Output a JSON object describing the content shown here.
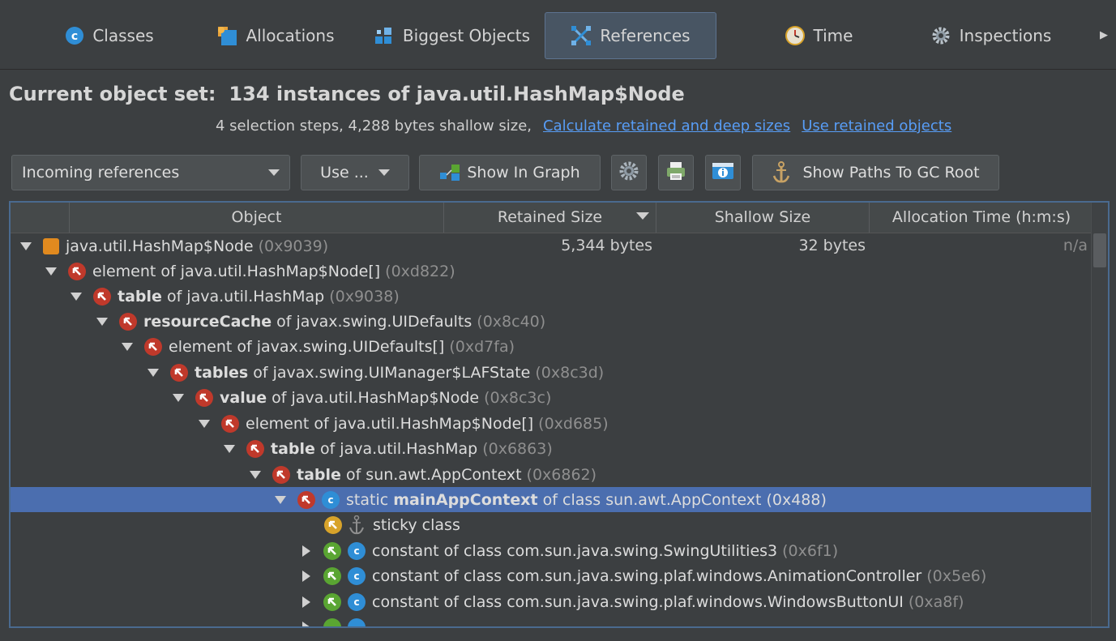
{
  "tabs": [
    {
      "label": "Classes",
      "icon": "classes-icon"
    },
    {
      "label": "Allocations",
      "icon": "allocations-icon"
    },
    {
      "label": "Biggest Objects",
      "icon": "biggest-objects-icon"
    },
    {
      "label": "References",
      "icon": "references-icon"
    },
    {
      "label": "Time",
      "icon": "time-icon"
    },
    {
      "label": "Inspections",
      "icon": "inspections-icon"
    }
  ],
  "header": {
    "title_label": "Current object set:",
    "title_value": "134 instances of java.util.HashMap$Node",
    "subtitle": "4 selection steps, 4,288 bytes shallow size,",
    "link_calc": "Calculate retained and deep sizes",
    "link_use": "Use retained objects"
  },
  "toolbar": {
    "combo_value": "Incoming references",
    "use_label": "Use ...",
    "graph_label": "Show In Graph",
    "gc_label": "Show Paths To GC Root"
  },
  "table": {
    "columns": [
      "Object",
      "Retained Size",
      "Shallow Size",
      "Allocation Time (h:m:s)"
    ],
    "root_retained": "5,344 bytes",
    "root_shallow": "32 bytes",
    "root_alloc": "n/a",
    "rows": [
      {
        "prefix": "",
        "bold": "",
        "text": "java.util.HashMap$Node",
        "addr": "(0x9039)"
      },
      {
        "prefix": "",
        "bold": "",
        "text": "element of java.util.HashMap$Node[]",
        "addr": "(0xd822)"
      },
      {
        "prefix": "",
        "bold": "table",
        "text": " of java.util.HashMap",
        "addr": "(0x9038)"
      },
      {
        "prefix": "",
        "bold": "resourceCache",
        "text": " of javax.swing.UIDefaults",
        "addr": "(0x8c40)"
      },
      {
        "prefix": "",
        "bold": "",
        "text": "element of javax.swing.UIDefaults[]",
        "addr": "(0xd7fa)"
      },
      {
        "prefix": "",
        "bold": "tables",
        "text": " of javax.swing.UIManager$LAFState",
        "addr": "(0x8c3d)"
      },
      {
        "prefix": "",
        "bold": "value",
        "text": " of java.util.HashMap$Node",
        "addr": "(0x8c3c)"
      },
      {
        "prefix": "",
        "bold": "",
        "text": "element of java.util.HashMap$Node[]",
        "addr": "(0xd685)"
      },
      {
        "prefix": "",
        "bold": "table",
        "text": " of java.util.HashMap",
        "addr": "(0x6863)"
      },
      {
        "prefix": "",
        "bold": "table",
        "text": " of sun.awt.AppContext",
        "addr": "(0x6862)"
      },
      {
        "prefix": "static ",
        "bold": "mainAppContext",
        "text": " of class sun.awt.AppContext",
        "addr": "(0x488)"
      },
      {
        "prefix": "",
        "bold": "",
        "text": "sticky class",
        "addr": ""
      },
      {
        "prefix": "",
        "bold": "",
        "text": "constant of class com.sun.java.swing.SwingUtilities3",
        "addr": "(0x6f1)"
      },
      {
        "prefix": "",
        "bold": "",
        "text": "constant of class com.sun.java.swing.plaf.windows.AnimationController",
        "addr": "(0x5e6)"
      },
      {
        "prefix": "",
        "bold": "",
        "text": "constant of class com.sun.java.swing.plaf.windows.WindowsButtonUI",
        "addr": "(0xa8f)"
      }
    ]
  }
}
